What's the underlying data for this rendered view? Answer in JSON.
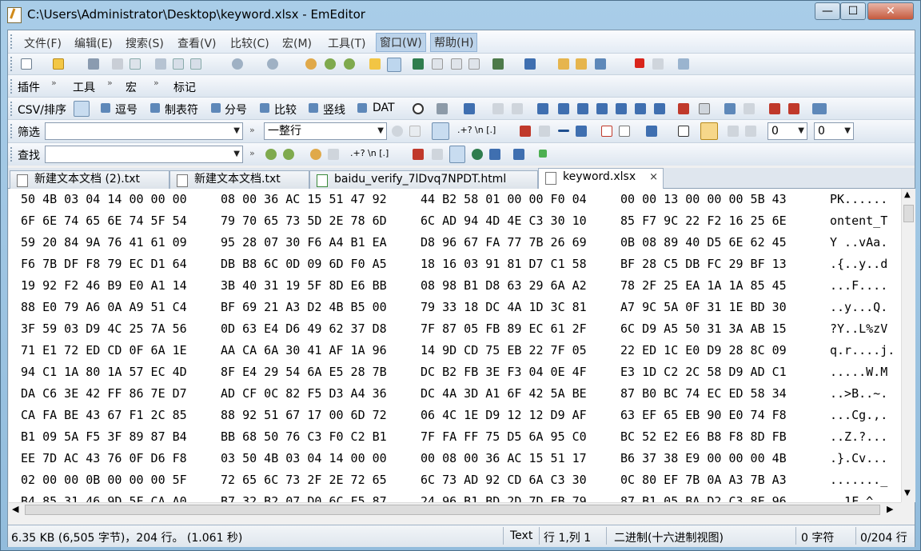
{
  "window": {
    "title": "C:\\Users\\Administrator\\Desktop\\keyword.xlsx - EmEditor",
    "minimize_glyph": "—",
    "maximize_glyph": "☐",
    "close_glyph": "✕"
  },
  "menu": [
    "文件(F)",
    "编辑(E)",
    "搜索(S)",
    "查看(V)",
    "比较(C)",
    "宏(M)",
    "工具(T)",
    "窗口(W)",
    "帮助(H)"
  ],
  "toolbar_plugins": {
    "plugins": "插件",
    "tools": "工具",
    "macros": "宏",
    "marks": "标记"
  },
  "csv_bar": {
    "label": "CSV/排序",
    "items": [
      "逗号",
      "制表符",
      "分号",
      "比较",
      "竖线",
      "DAT"
    ]
  },
  "filter_bar": {
    "label": "筛选",
    "value": "",
    "mode": "一整行",
    "num1": "0",
    "num2": "0"
  },
  "find_bar": {
    "label": "查找",
    "value": ""
  },
  "tabs": [
    {
      "label": "新建文本文档 (2).txt",
      "active": false
    },
    {
      "label": "新建文本文档.txt",
      "active": false
    },
    {
      "label": "baidu_verify_7lDvq7NPDT.html",
      "active": false
    },
    {
      "label": "keyword.xlsx",
      "active": true,
      "close": "×"
    }
  ],
  "hex_rows": [
    {
      "g1": "50 4B 03 04 14 00 00 00",
      "g2": "08 00 36 AC 15 51 47 92",
      "g3": "44 B2 58 01 00 00 F0 04",
      "g4": "00 00 13 00 00 00 5B 43",
      "ascii": "PK......"
    },
    {
      "g1": "6F 6E 74 65 6E 74 5F 54",
      "g2": "79 70 65 73 5D 2E 78 6D",
      "g3": "6C AD 94 4D 4E C3 30 10",
      "g4": "85 F7 9C 22 F2 16 25 6E",
      "ascii": "ontent_T"
    },
    {
      "g1": "59 20 84 9A 76 41 61 09",
      "g2": "95 28 07 30 F6 A4 B1 EA",
      "g3": "D8 96 67 FA 77 7B 26 69",
      "g4": "0B 08 89 40 D5 6E 62 45",
      "ascii": "Y ..vAa."
    },
    {
      "g1": "F6 7B DF F8 79 EC D1 64",
      "g2": "DB B8 6C 0D 09 6D F0 A5",
      "g3": "18 16 03 91 81 D7 C1 58",
      "g4": "BF 28 C5 DB FC 29 BF 13",
      "ascii": ".{..y..d"
    },
    {
      "g1": "19 92 F2 46 B9 E0 A1 14",
      "g2": "3B 40 31 19 5F 8D E6 BB",
      "g3": "08 98 B1 D8 63 29 6A A2",
      "g4": "78 2F 25 EA 1A 1A 85 45",
      "ascii": "...F...."
    },
    {
      "g1": "88 E0 79 A6 0A A9 51 C4",
      "g2": "BF 69 21 A3 D2 4B B5 00",
      "g3": "79 33 18 DC 4A 1D 3C 81",
      "g4": "A7 9C 5A 0F 31 1E BD 30",
      "ascii": "..y...Q."
    },
    {
      "g1": "3F 59 03 D9 4C 25 7A 56",
      "g2": "0D 63 E4 D6 49 62 37 D8",
      "g3": "7F 87 05 FB 89 EC 61 2F",
      "g4": "6C D9 A5 50 31 3A AB 15",
      "ascii": "?Y..L%zV"
    },
    {
      "g1": "71 E1 72 ED CD 0F 6A 1E",
      "g2": "AA CA 6A 30 41 AF 1A 96",
      "g3": "14 9D CD 75 EB 22 7F 05",
      "g4": "22 ED 1C E0 D9 28 8C 09",
      "ascii": "q.r....j."
    },
    {
      "g1": "94 C1 1A 80 1A 57 EC 4D",
      "g2": "8F E4 29 54 6A E5 28 7B",
      "g3": "DC B2 FB 3E F3 04 0E 4F",
      "g4": "E3 1D C2 2C 58 D9 AD C1",
      "ascii": ".....W.M"
    },
    {
      "g1": "DA C6 3E 42 FF 86 7E D7",
      "g2": "AD CF 0C 82 F5 D3 A4 36",
      "g3": "DC 4A 3D A1 6F 42 5A BE",
      "g4": "87 B0 BC 74 EC ED 58 34",
      "ascii": "..>B..~."
    },
    {
      "g1": "CA FA BE 43 67 F1 2C 85",
      "g2": "88 92 51 67 17 00 6D 72",
      "g3": "06 4C 1E D9 12 12 D9 AF",
      "g4": "63 EF 65 EB 90 E0 74 F8",
      "ascii": "...Cg.,."
    },
    {
      "g1": "B1 09 5A F5 3F 89 87 B4",
      "g2": "BB 68 50 76 C3 F0 C2 B1",
      "g3": "7F FA FF 75 D5 6A 95 C0",
      "g4": "BC 52 E2 E6 B8 F8 8D FB",
      "ascii": "..Z.?..."
    },
    {
      "g1": "EE 7D AC 43 76 0F D6 F8",
      "g2": "03 50 4B 03 04 14 00 00",
      "g3": "00 08 00 36 AC 15 51 17",
      "g4": "B6 37 38 E9 00 00 00 4B",
      "ascii": ".}.Cv..."
    },
    {
      "g1": "02 00 00 0B 00 00 00 5F",
      "g2": "72 65 6C 73 2F 2E 72 65",
      "g3": "6C 73 AD 92 CD 6A C3 30",
      "g4": "0C 80 EF 7B 0A A3 7B A3",
      "ascii": "......._"
    },
    {
      "g1": "B4 85 31 46 9D 5F CA A0",
      "g2": "B7 32 B2 07 D0 6C F5 87",
      "g3": "24 96 B1 BD 2D 7D FB 79",
      "g4": "87 B1 05 BA D2 C3 8F 96",
      "ascii": "..1F.^.."
    }
  ],
  "status": {
    "info": "6.35 KB (6,505 字节)，204 行。 (1.061 秒)",
    "mode": "Text",
    "position": "行 1,列 1",
    "view": "二进制(十六进制视图)",
    "chars": "0 字符",
    "lines": "0/204 行"
  }
}
